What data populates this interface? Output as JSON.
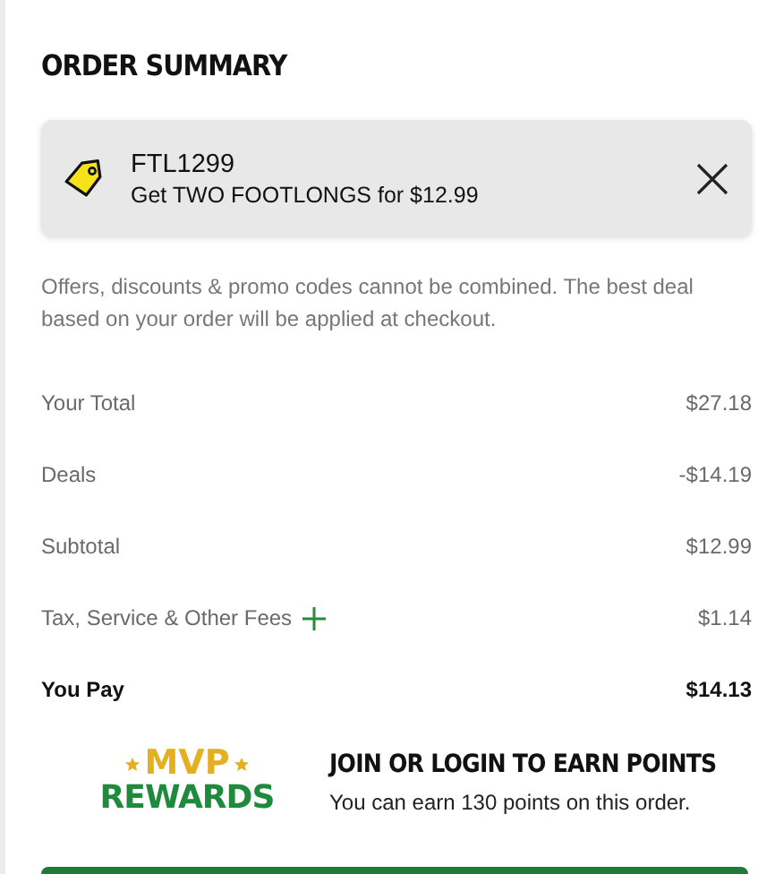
{
  "title": "ORDER SUMMARY",
  "promo": {
    "code": "FTL1299",
    "description": "Get TWO FOOTLONGS for $12.99"
  },
  "note": "Offers, discounts & promo codes cannot be combined. The best deal based on your order will be applied at checkout.",
  "rows": [
    {
      "label": "Your Total",
      "value": "$27.18",
      "expandable": false,
      "emphasis": false
    },
    {
      "label": "Deals",
      "value": "-$14.19",
      "expandable": false,
      "emphasis": false
    },
    {
      "label": "Subtotal",
      "value": "$12.99",
      "expandable": false,
      "emphasis": false
    },
    {
      "label": "Tax, Service & Other Fees",
      "value": "$1.14",
      "expandable": true,
      "emphasis": false
    },
    {
      "label": "You Pay",
      "value": "$14.13",
      "expandable": false,
      "emphasis": true
    }
  ],
  "rewards": {
    "logo_top": "MVP",
    "logo_bottom": "REWARDS",
    "heading": "JOIN OR LOGIN TO EARN POINTS",
    "text": "You can earn 130 points on this order."
  }
}
